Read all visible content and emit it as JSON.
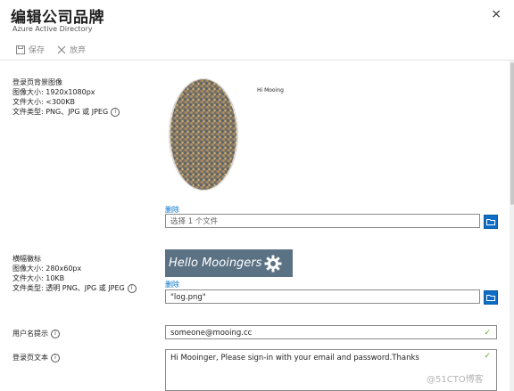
{
  "blade": {
    "title": "编辑公司品牌",
    "subtitle": "Azure Active Directory",
    "close_icon": "×"
  },
  "commands": {
    "save": "保存",
    "discard": "放弃"
  },
  "sections": {
    "background": {
      "title": "登录页背景图像",
      "size": "图像大小: 1920x1080px",
      "filesize": "文件大小: <300KB",
      "filetype": "文件类型: PNG、JPG 或 JPEG",
      "preview_text": "Hi Mooing",
      "remove": "删除",
      "file_placeholder": "选择 1 个文件"
    },
    "banner": {
      "title": "横幅徽标",
      "size": "图像大小: 280x60px",
      "filesize": "文件大小: 10KB",
      "filetype": "文件类型: 透明 PNG、JPG 或 JPEG",
      "logo_text": "Hello Mooingers",
      "remove": "删除",
      "file_value": "\"log.png\""
    },
    "username_hint": {
      "label": "用户名提示",
      "value": "someone@mooing.cc"
    },
    "signin_text": {
      "label": "登录页文本",
      "value": "Hi Mooinger, Please sign-in with your email and password.Thanks"
    }
  },
  "watermark": "@51CTO博客",
  "colors": {
    "accent": "#0e6ec5",
    "link": "#0072c6",
    "valid": "#5da82b",
    "banner_bg": "#5b7184"
  }
}
